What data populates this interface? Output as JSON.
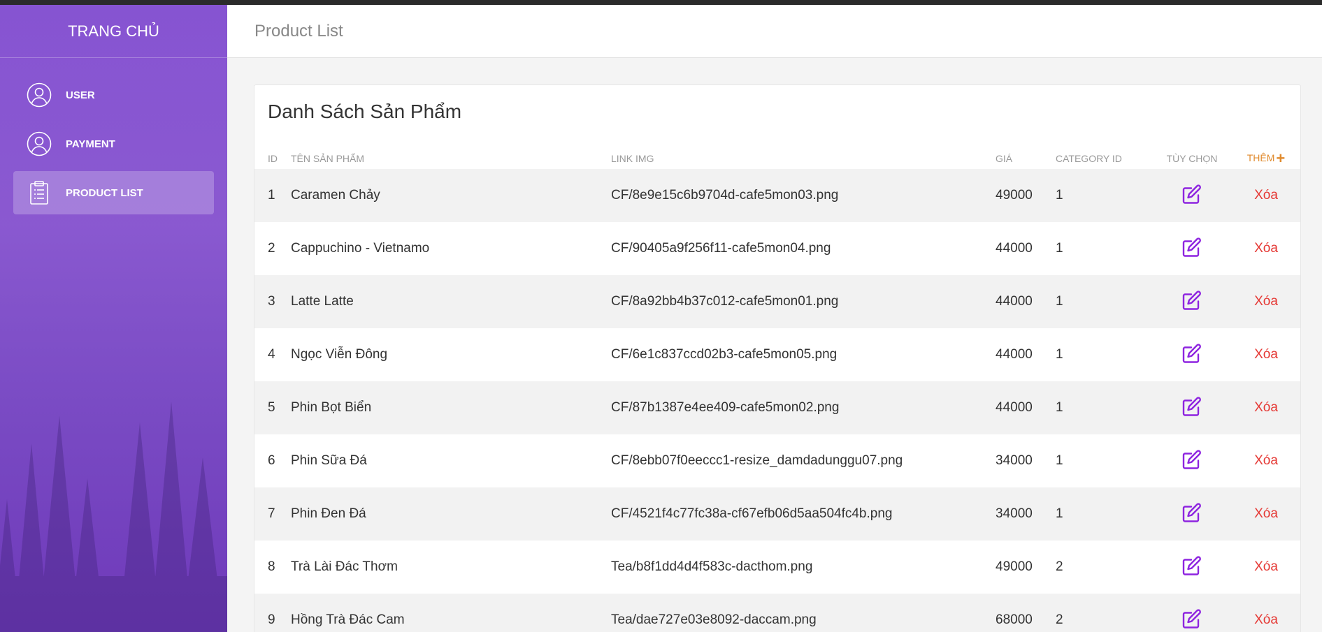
{
  "sidebar": {
    "brand": "TRANG CHỦ",
    "items": [
      {
        "label": "USER",
        "icon": "user-icon"
      },
      {
        "label": "PAYMENT",
        "icon": "user-icon"
      },
      {
        "label": "PRODUCT LIST",
        "icon": "clipboard-icon",
        "active": true
      }
    ]
  },
  "header": {
    "title": "Product List"
  },
  "main": {
    "card_title": "Danh Sách Sản Phẩm",
    "columns": {
      "id": "ID",
      "name": "TÊN SẢN PHẨM",
      "link": "LINK IMG",
      "price": "GIÁ",
      "category": "CATEGORY ID",
      "options": "TÙY CHỌN",
      "add": "THÊM"
    },
    "delete_label": "Xóa",
    "rows": [
      {
        "id": "1",
        "name": "Caramen Chảy",
        "link": "CF/8e9e15c6b9704d-cafe5mon03.png",
        "price": "49000",
        "category": "1"
      },
      {
        "id": "2",
        "name": "Cappuchino - Vietnamo",
        "link": "CF/90405a9f256f11-cafe5mon04.png",
        "price": "44000",
        "category": "1"
      },
      {
        "id": "3",
        "name": "Latte Latte",
        "link": "CF/8a92bb4b37c012-cafe5mon01.png",
        "price": "44000",
        "category": "1"
      },
      {
        "id": "4",
        "name": "Ngọc Viễn Đông",
        "link": "CF/6e1c837ccd02b3-cafe5mon05.png",
        "price": "44000",
        "category": "1"
      },
      {
        "id": "5",
        "name": "Phin Bọt Biển",
        "link": "CF/87b1387e4ee409-cafe5mon02.png",
        "price": "44000",
        "category": "1"
      },
      {
        "id": "6",
        "name": "Phin Sữa Đá",
        "link": "CF/8ebb07f0eeccc1-resize_damdadunggu07.png",
        "price": "34000",
        "category": "1"
      },
      {
        "id": "7",
        "name": "Phin Đen Đá",
        "link": "CF/4521f4c77fc38a-cf67efb06d5aa504fc4b.png",
        "price": "34000",
        "category": "1"
      },
      {
        "id": "8",
        "name": "Trà Lài Đác Thơm",
        "link": "Tea/b8f1dd4d4f583c-dacthom.png",
        "price": "49000",
        "category": "2"
      },
      {
        "id": "9",
        "name": "Hồng Trà Đác Cam",
        "link": "Tea/dae727e03e8092-daccam.png",
        "price": "68000",
        "category": "2"
      }
    ]
  },
  "colors": {
    "sidebar": "#8a55d4",
    "accent_edit": "#8e24e0",
    "delete": "#e53935",
    "add": "#e08a2c"
  }
}
